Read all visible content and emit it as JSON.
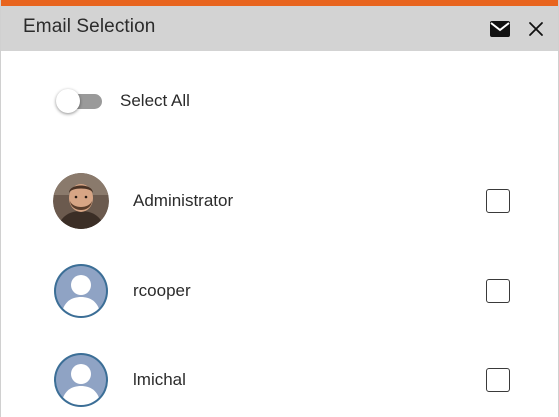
{
  "dialog": {
    "title": "Email Selection",
    "icons": [
      "envelope-icon",
      "close-icon"
    ],
    "accent_color": "#e8641e",
    "header_color": "#d3d3d3"
  },
  "select_all": {
    "label": "Select All",
    "checked": false
  },
  "users": [
    {
      "name": "Administrator",
      "avatar": "photo",
      "checked": false
    },
    {
      "name": "rcooper",
      "avatar": "default-avatar",
      "checked": false
    },
    {
      "name": "lmichal",
      "avatar": "default-avatar",
      "checked": false
    }
  ]
}
